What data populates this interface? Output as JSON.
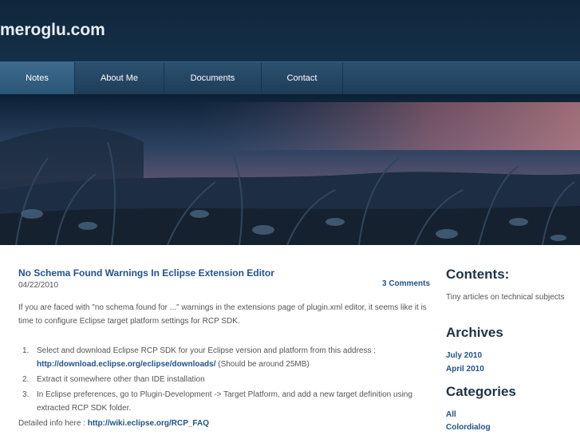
{
  "header": {
    "site_title": "meroglu.com"
  },
  "nav": {
    "items": [
      "Notes",
      "About Me",
      "Documents",
      "Contact"
    ]
  },
  "post": {
    "title": "No Schema Found Warnings In Eclipse Extension Editor",
    "date": "04/22/2010",
    "comments": "3 Comments",
    "intro_line1": "If you are faced with \"no schema found for ...\" warnings in the extensions page of plugin.xml editor, it seems like it is",
    "intro_line2": "time to configure Eclipse target platform settings for RCP SDK.",
    "steps": [
      {
        "num": "1.",
        "text": " Select and download Eclipse RCP SDK for your Eclipse version and platform from this address :",
        "link": "http://download.eclipse.org/eclipse/downloads/",
        "after": " (Should be around 25MB)"
      },
      {
        "num": "2.",
        "text": "Extract it somewhere other than IDE installation"
      },
      {
        "num": "3.",
        "text": "In Eclipse preferences, go to Plugin-Development -> Target Platform, and add a new target definition using extracted RCP SDK folder."
      }
    ],
    "detail_label": "Detailed info here :",
    "detail_link": "http://wiki.eclipse.org/RCP_FAQ"
  },
  "sidebar": {
    "contents_title": "Contents:",
    "contents_text": "Tiny articles on technical subjects",
    "archives_title": "Archives",
    "archives": [
      "July 2010",
      "April 2010"
    ],
    "categories_title": "Categories",
    "categories": [
      "All",
      "Colordialog"
    ]
  }
}
